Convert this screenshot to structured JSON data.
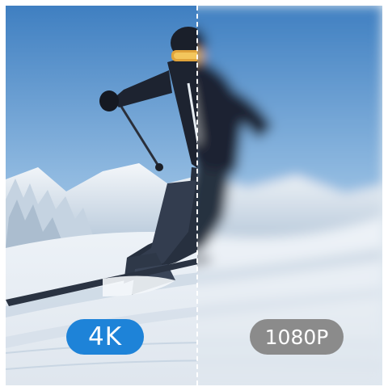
{
  "image": {
    "subject": "skier",
    "left_badge": {
      "label": "4K",
      "color": "#1e83d8"
    },
    "right_badge": {
      "label": "1080P",
      "color": "#8b8b8b"
    },
    "divider_style": "dashed-white",
    "sharpness": {
      "left": "sharp",
      "right": "blurred"
    }
  }
}
